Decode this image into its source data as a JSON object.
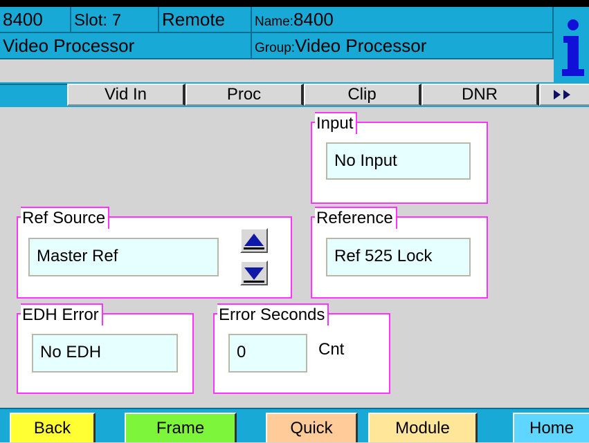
{
  "header": {
    "model": "8400",
    "slot": "Slot: 7",
    "mode": "Remote",
    "name_prefix": "Name:",
    "name_value": "8400",
    "description": "Video Processor",
    "group_prefix": "Group:",
    "group_value": "Video Processor",
    "info_icon": "info-icon"
  },
  "tabs": [
    {
      "label": "Vid In"
    },
    {
      "label": "Proc"
    },
    {
      "label": "Clip"
    },
    {
      "label": "DNR"
    }
  ],
  "tabs_more_icon": "double-right-arrow-icon",
  "groups": {
    "input": {
      "label": "Input",
      "value": "No Input"
    },
    "ref_source": {
      "label": "Ref Source",
      "value": "Master Ref"
    },
    "reference": {
      "label": "Reference",
      "value": "Ref 525 Lock"
    },
    "edh_error": {
      "label": "EDH Error",
      "value": "No EDH"
    },
    "error_seconds": {
      "label": "Error Seconds",
      "value": "0",
      "unit": "Cnt"
    }
  },
  "nav": {
    "back": {
      "label": "Back",
      "color": "#ffff33"
    },
    "frame": {
      "label": "Frame",
      "color": "#7cf53a"
    },
    "quick": {
      "label": "Quick",
      "color": "#ffcc99"
    },
    "module": {
      "label": "Module",
      "color": "#ffe699"
    },
    "home": {
      "label": "Home",
      "color": "#5fd6ff"
    }
  },
  "colors": {
    "header_bg": "#19a9d7",
    "panel_bg": "#d4d4d4",
    "group_border": "#ff33ff",
    "field_bg": "#e6ffff",
    "info_blue": "#1010d8",
    "nav_bar_bg": "#19a9d7"
  }
}
